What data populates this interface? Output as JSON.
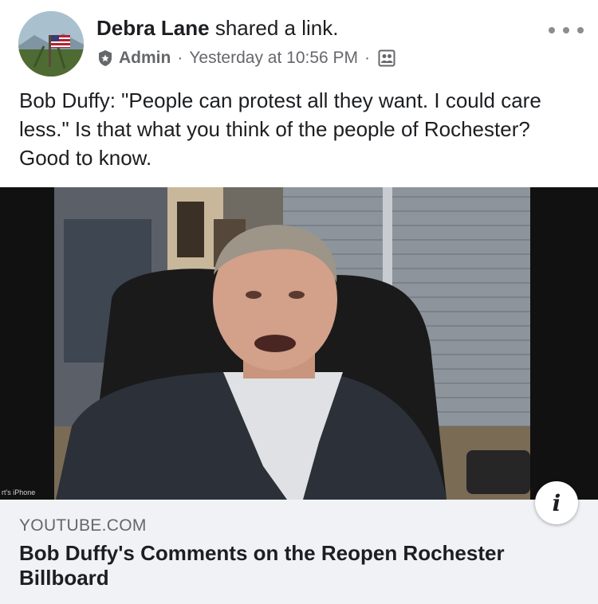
{
  "post": {
    "author": "Debra Lane",
    "action": " shared a link.",
    "role": "Admin",
    "separator": "·",
    "timestamp": "Yesterday at 10:56 PM",
    "audience_icon": "group-icon",
    "badge_icon": "admin-badge-icon",
    "more_icon": "more-options-icon",
    "text": "Bob Duffy: \"People can protest all they want.  I could care less.\"  Is that what you think of the people of Rochester?  Good to know."
  },
  "link": {
    "domain": "YOUTUBE.COM",
    "title": "Bob Duffy's Comments on the Reopen Rochester Billboard",
    "info_label": "i",
    "video_caption": "rt's iPhone"
  },
  "colors": {
    "text_primary": "#1c1e21",
    "text_secondary": "#65676b",
    "card_background": "#f0f2f5",
    "video_background": "#0d0d0d"
  }
}
